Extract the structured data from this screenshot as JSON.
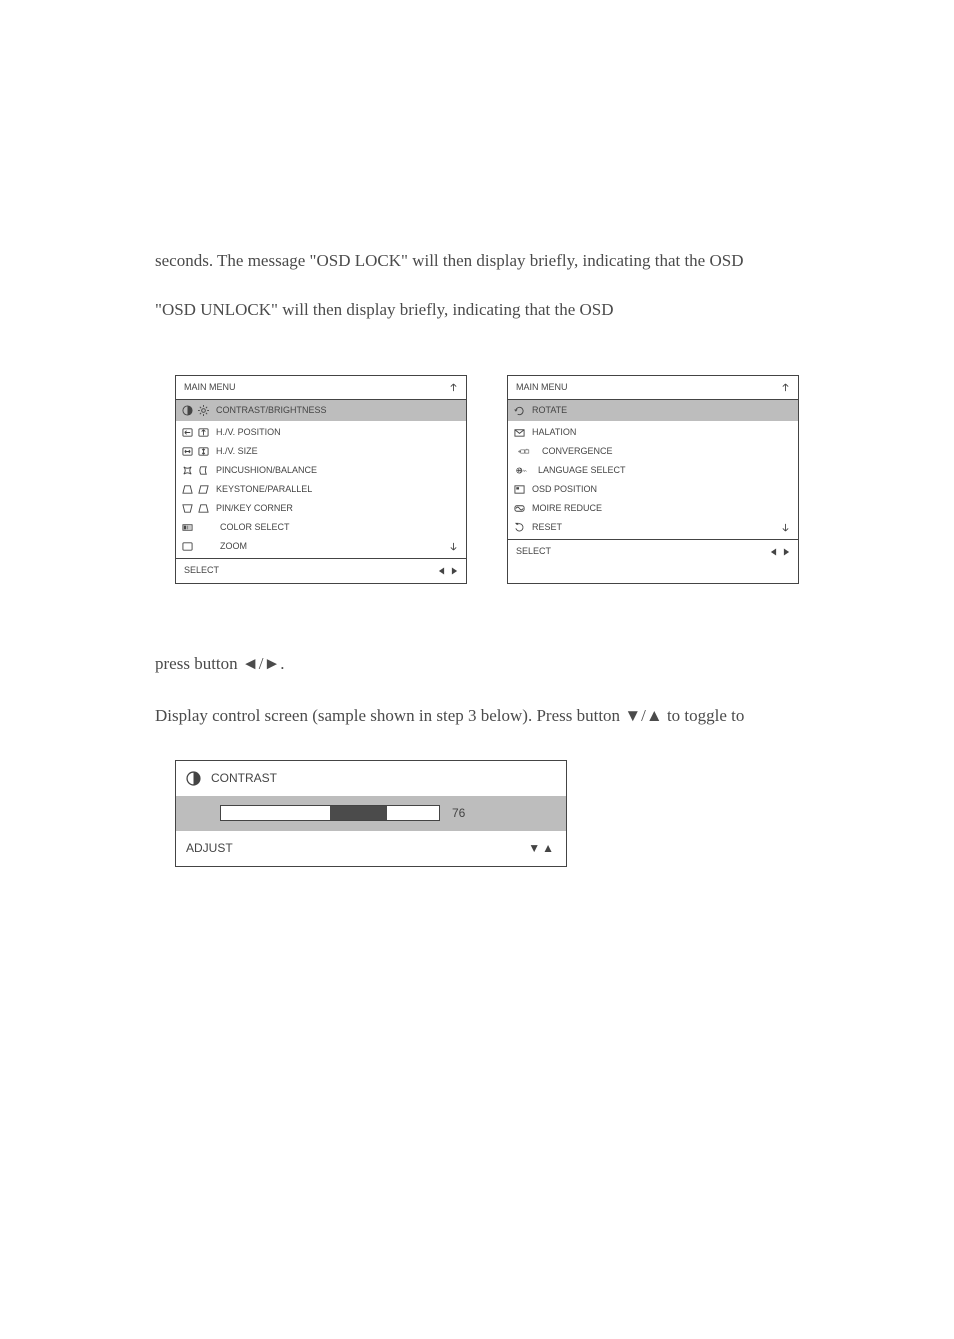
{
  "text": {
    "para1": "seconds. The message \"OSD LOCK\" will then display briefly, indicating that the OSD",
    "para2": "\"OSD UNLOCK\" will then display briefly, indicating that the OSD",
    "step_press": "press button ",
    "step_display": "Display control screen (sample shown in step 3 below). Press button ",
    "step_toggle_suffix": " to toggle to"
  },
  "osd": {
    "panel1": {
      "title": "MAIN MENU",
      "highlight": {
        "label": "CONTRAST/BRIGHTNESS"
      },
      "rows": [
        {
          "label": "H./V. POSITION"
        },
        {
          "label": "H./V. SIZE"
        },
        {
          "label": "PINCUSHION/BALANCE"
        },
        {
          "label": "KEYSTONE/PARALLEL"
        },
        {
          "label": "PIN/KEY CORNER"
        },
        {
          "label": "COLOR SELECT"
        },
        {
          "label": "ZOOM",
          "lastArrow": true
        }
      ],
      "footer": "SELECT"
    },
    "panel2": {
      "title": "MAIN MENU",
      "highlight": {
        "label": "ROTATE"
      },
      "rows": [
        {
          "label": "HALATION"
        },
        {
          "label": "CONVERGENCE"
        },
        {
          "label": "LANGUAGE SELECT"
        },
        {
          "label": "OSD POSITION"
        },
        {
          "label": "MOIRE REDUCE"
        },
        {
          "label": "RESET",
          "lastArrow": true
        }
      ],
      "footer": "SELECT"
    }
  },
  "control": {
    "title": "CONTRAST",
    "value": "76",
    "footer": "ADJUST"
  }
}
